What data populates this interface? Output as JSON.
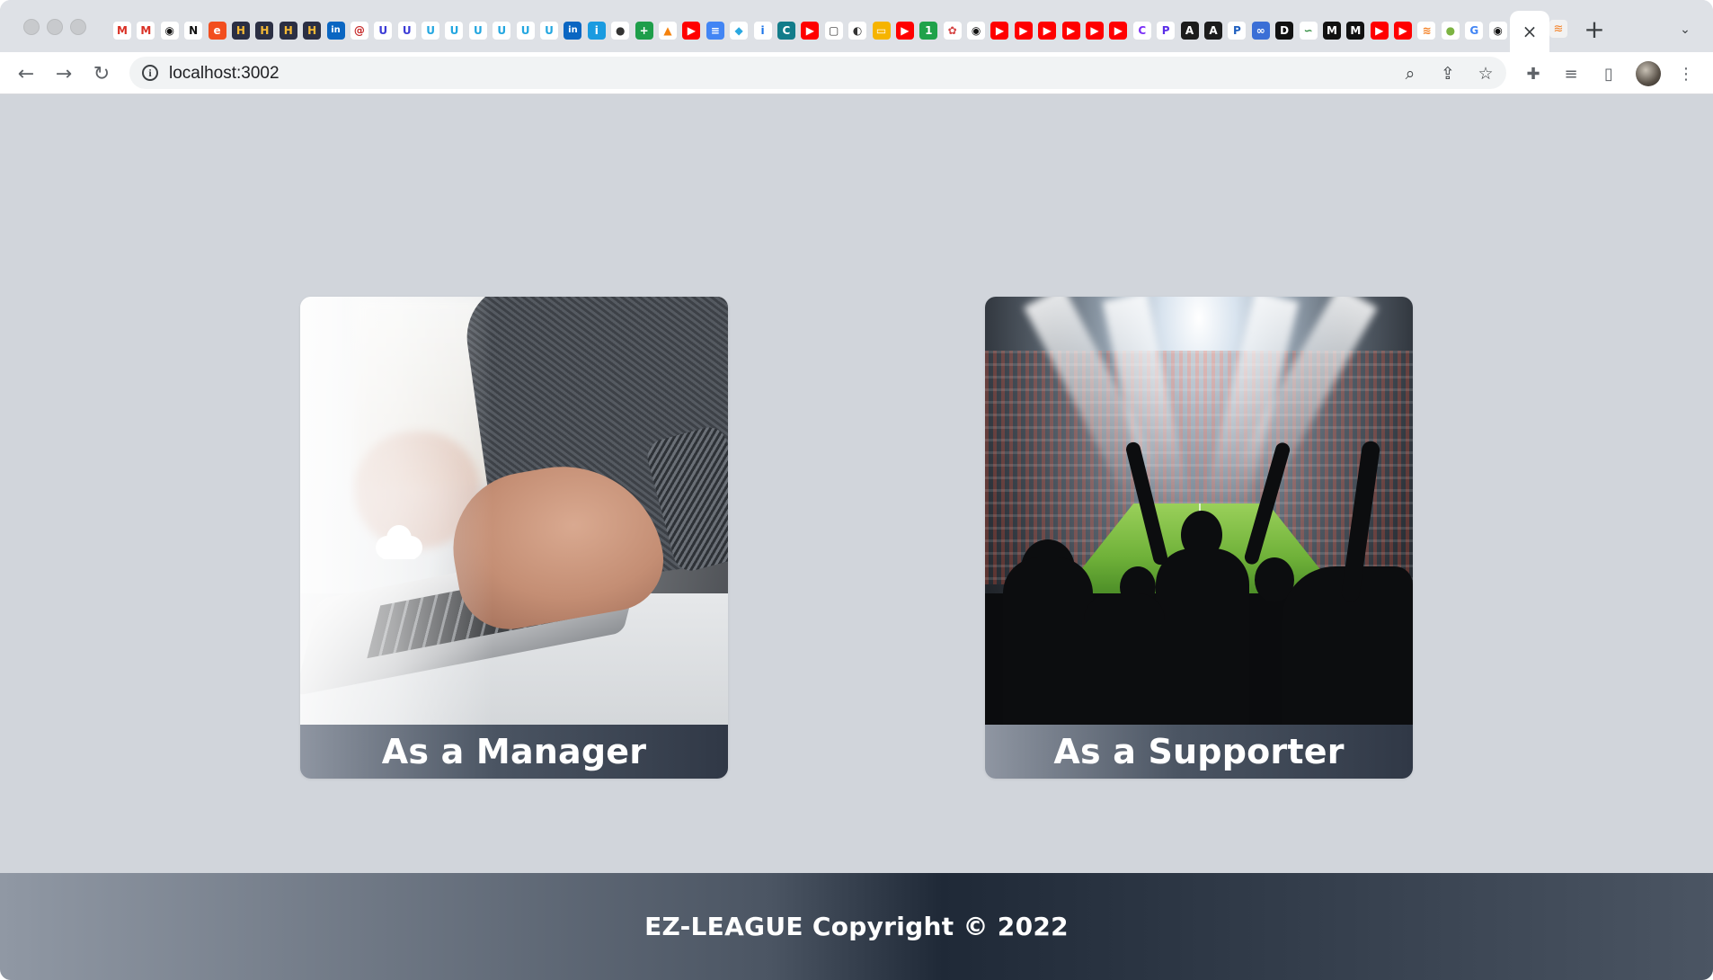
{
  "browser": {
    "url": "localhost:3002",
    "favicons": [
      {
        "icon": "gmail-icon",
        "glyph": "M",
        "bg": "#ffffff",
        "color": "#d93025"
      },
      {
        "icon": "gmail-icon",
        "glyph": "M",
        "bg": "#ffffff",
        "color": "#d93025"
      },
      {
        "icon": "github-icon",
        "glyph": "◉",
        "bg": "#ffffff",
        "color": "#111111"
      },
      {
        "icon": "notion-icon",
        "glyph": "N",
        "bg": "#ffffff",
        "color": "#111111"
      },
      {
        "icon": "edge-icon",
        "glyph": "e",
        "bg": "#f24e1e",
        "color": "#ffffff"
      },
      {
        "icon": "hackerrank-icon",
        "glyph": "H",
        "bg": "#2b2f44",
        "color": "#f5b935"
      },
      {
        "icon": "hackerrank-icon",
        "glyph": "H",
        "bg": "#2b2f44",
        "color": "#f5b935"
      },
      {
        "icon": "hackerrank-icon",
        "glyph": "H",
        "bg": "#2b2f44",
        "color": "#f5b935"
      },
      {
        "icon": "hackerrank-icon",
        "glyph": "H",
        "bg": "#2b2f44",
        "color": "#f5b935"
      },
      {
        "icon": "linkedin-icon",
        "glyph": "in",
        "bg": "#0a66c2",
        "color": "#ffffff"
      },
      {
        "icon": "site-icon",
        "glyph": "@",
        "bg": "#ffffff",
        "color": "#c62828"
      },
      {
        "icon": "udemy-icon",
        "glyph": "U",
        "bg": "#ffffff",
        "color": "#3b3bd6"
      },
      {
        "icon": "udemy-icon",
        "glyph": "U",
        "bg": "#ffffff",
        "color": "#3b3bd6"
      },
      {
        "icon": "udemy-icon",
        "glyph": "U",
        "bg": "#ffffff",
        "color": "#22a6e0"
      },
      {
        "icon": "udemy-icon",
        "glyph": "U",
        "bg": "#ffffff",
        "color": "#22a6e0"
      },
      {
        "icon": "udemy-icon",
        "glyph": "U",
        "bg": "#ffffff",
        "color": "#22a6e0"
      },
      {
        "icon": "udemy-icon",
        "glyph": "U",
        "bg": "#ffffff",
        "color": "#22a6e0"
      },
      {
        "icon": "udemy-icon",
        "glyph": "U",
        "bg": "#ffffff",
        "color": "#22a6e0"
      },
      {
        "icon": "udemy-icon",
        "glyph": "U",
        "bg": "#ffffff",
        "color": "#22a6e0"
      },
      {
        "icon": "linkedin-icon",
        "glyph": "in",
        "bg": "#0a66c2",
        "color": "#ffffff"
      },
      {
        "icon": "info-site-icon",
        "glyph": "i",
        "bg": "#1a9be0",
        "color": "#ffffff"
      },
      {
        "icon": "circle-site-icon",
        "glyph": "●",
        "bg": "#ffffff",
        "color": "#333333"
      },
      {
        "icon": "plus-site-icon",
        "glyph": "+",
        "bg": "#1e9e4a",
        "color": "#ffffff"
      },
      {
        "icon": "firebase-icon",
        "glyph": "▲",
        "bg": "#ffffff",
        "color": "#f5820d"
      },
      {
        "icon": "youtube-icon",
        "glyph": "▶",
        "bg": "#ff0000",
        "color": "#ffffff"
      },
      {
        "icon": "docs-icon",
        "glyph": "≡",
        "bg": "#4285f4",
        "color": "#ffffff"
      },
      {
        "icon": "slides-icon",
        "glyph": "◆",
        "bg": "#ffffff",
        "color": "#2aa8e0"
      },
      {
        "icon": "info-site-icon",
        "glyph": "ⅰ",
        "bg": "#ffffff",
        "color": "#1a73e8"
      },
      {
        "icon": "codecademy-icon",
        "glyph": "C",
        "bg": "#127c8a",
        "color": "#ffffff"
      },
      {
        "icon": "youtube-icon",
        "glyph": "▶",
        "bg": "#ff0000",
        "color": "#ffffff"
      },
      {
        "icon": "square-site-icon",
        "glyph": "▢",
        "bg": "#ffffff",
        "color": "#333333"
      },
      {
        "icon": "globe-icon",
        "glyph": "◐",
        "bg": "#ffffff",
        "color": "#333333"
      },
      {
        "icon": "slides-icon",
        "glyph": "▭",
        "bg": "#f6b400",
        "color": "#ffffff"
      },
      {
        "icon": "youtube-icon",
        "glyph": "▶",
        "bg": "#ff0000",
        "color": "#ffffff"
      },
      {
        "icon": "green-site-icon",
        "glyph": "1",
        "bg": "#1fa24a",
        "color": "#ffffff"
      },
      {
        "icon": "openai-icon",
        "glyph": "✿",
        "bg": "#ffffff",
        "color": "#d64545"
      },
      {
        "icon": "github-icon",
        "glyph": "◉",
        "bg": "#ffffff",
        "color": "#111111"
      },
      {
        "icon": "youtube-icon",
        "glyph": "▶",
        "bg": "#ff0000",
        "color": "#ffffff"
      },
      {
        "icon": "youtube-icon",
        "glyph": "▶",
        "bg": "#ff0000",
        "color": "#ffffff"
      },
      {
        "icon": "youtube-icon",
        "glyph": "▶",
        "bg": "#ff0000",
        "color": "#ffffff"
      },
      {
        "icon": "youtube-icon",
        "glyph": "▶",
        "bg": "#ff0000",
        "color": "#ffffff"
      },
      {
        "icon": "youtube-icon",
        "glyph": "▶",
        "bg": "#ff0000",
        "color": "#ffffff"
      },
      {
        "icon": "youtube-icon",
        "glyph": "▶",
        "bg": "#ff0000",
        "color": "#ffffff"
      },
      {
        "icon": "canva-icon",
        "glyph": "C",
        "bg": "#ffffff",
        "color": "#7b2ff7"
      },
      {
        "icon": "flag-site-icon",
        "glyph": "P",
        "bg": "#ffffff",
        "color": "#5b2ee8"
      },
      {
        "icon": "a-site-icon",
        "glyph": "A",
        "bg": "#1c1c1c",
        "color": "#ffffff"
      },
      {
        "icon": "a-site-icon",
        "glyph": "A",
        "bg": "#1c1c1c",
        "color": "#ffffff"
      },
      {
        "icon": "paypal-icon",
        "glyph": "P",
        "bg": "#ffffff",
        "color": "#1f5fbf"
      },
      {
        "icon": "infinity-icon",
        "glyph": "∞",
        "bg": "#3b6fd6",
        "color": "#ffffff"
      },
      {
        "icon": "dev-icon",
        "glyph": "D",
        "bg": "#111111",
        "color": "#ffffff"
      },
      {
        "icon": "link-site-icon",
        "glyph": "∽",
        "bg": "#ffffff",
        "color": "#2e8b3e"
      },
      {
        "icon": "medium-icon",
        "glyph": "M",
        "bg": "#111111",
        "color": "#ffffff"
      },
      {
        "icon": "medium-icon",
        "glyph": "M",
        "bg": "#111111",
        "color": "#ffffff"
      },
      {
        "icon": "youtube-icon",
        "glyph": "▶",
        "bg": "#ff0000",
        "color": "#ffffff"
      },
      {
        "icon": "youtube-icon",
        "glyph": "▶",
        "bg": "#ff0000",
        "color": "#ffffff"
      },
      {
        "icon": "stackoverflow-icon",
        "glyph": "≋",
        "bg": "#ffffff",
        "color": "#f48024"
      },
      {
        "icon": "leaf-icon",
        "glyph": "●",
        "bg": "#ffffff",
        "color": "#7cb342"
      },
      {
        "icon": "google-icon",
        "glyph": "G",
        "bg": "#ffffff",
        "color": "#4285f4"
      },
      {
        "icon": "github-icon",
        "glyph": "◉",
        "bg": "#ffffff",
        "color": "#111111"
      }
    ],
    "active_tab_close": "×",
    "tab_after": "≋",
    "new_tab": "+",
    "tab_menu": "⌄",
    "nav": {
      "back": "←",
      "forward": "→",
      "reload": "↻"
    },
    "omnibox_icons": {
      "zoom": "⌕",
      "share": "⇪",
      "star": "☆"
    },
    "toolbar_icons": {
      "extensions": "✚",
      "reading_list": "≡",
      "side_panel": "▯",
      "menu": "⋮"
    }
  },
  "cards": [
    {
      "label": "As a Manager"
    },
    {
      "label": "As a Supporter"
    }
  ],
  "footer": {
    "text": "EZ-LEAGUE Copyright © 2022"
  },
  "colors": {
    "page_bg": "#d1d5db",
    "caption_gradient_start": "#8f96a2",
    "caption_gradient_end": "#303846"
  }
}
